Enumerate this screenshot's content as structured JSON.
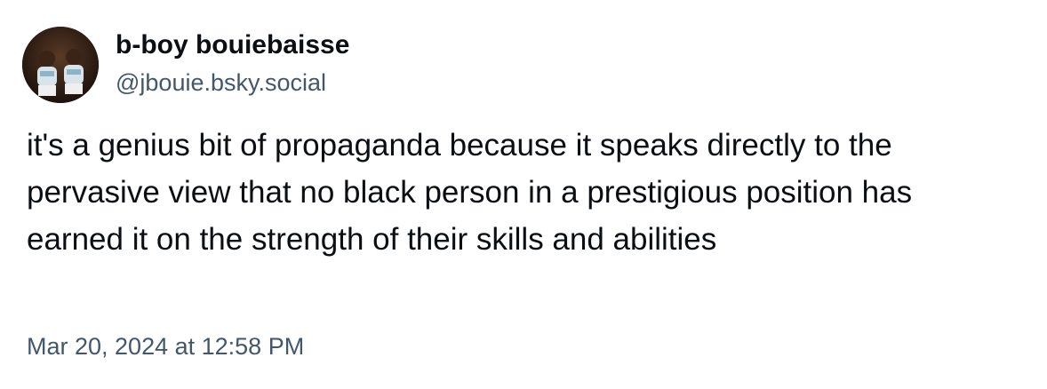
{
  "post": {
    "author": {
      "display_name": "b-boy bouiebaisse",
      "handle": "@jbouie.bsky.social",
      "avatar_icon": "profile-photo-avatar"
    },
    "text": "it's a genius bit of propaganda because it speaks directly to the pervasive view that no black person in a prestigious position has earned it on the strength of their skills and abilities",
    "timestamp": "Mar 20, 2024 at 12:58 PM"
  },
  "colors": {
    "text_primary": "#0b0f14",
    "text_secondary": "#42576c",
    "background": "#ffffff"
  }
}
